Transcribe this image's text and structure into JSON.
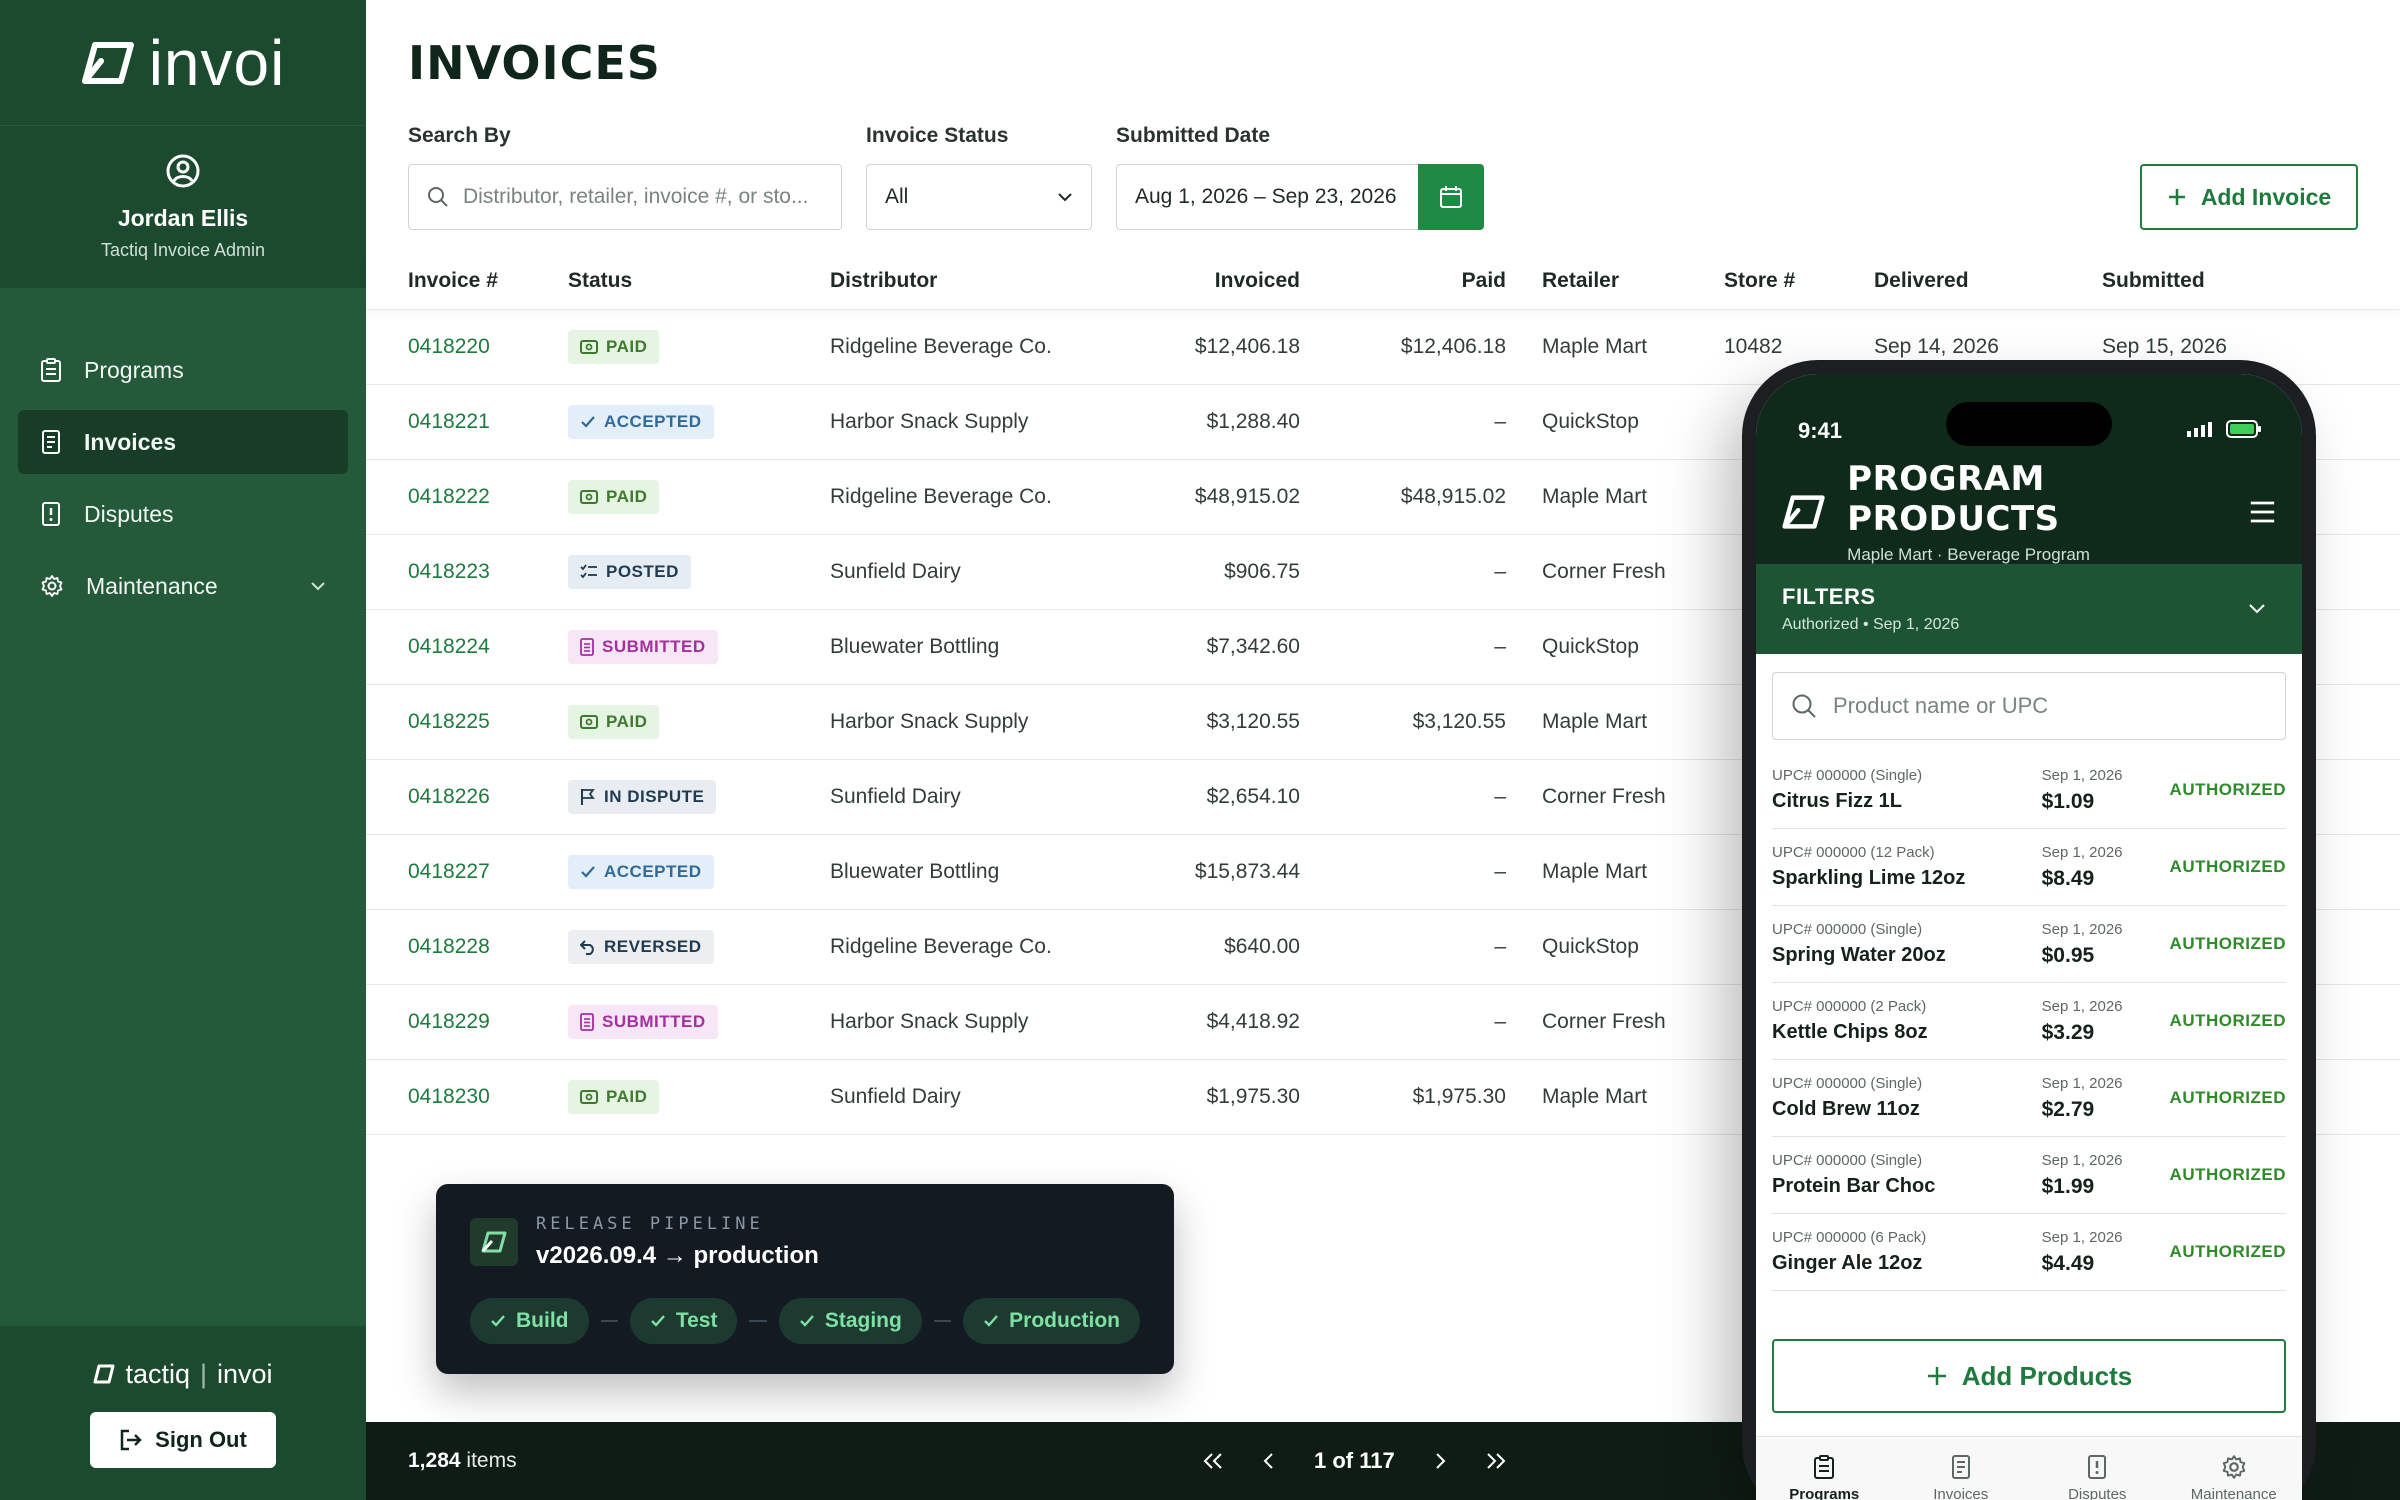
{
  "sidebar": {
    "logo_text": "invoi",
    "user": {
      "name": "Jordan Ellis",
      "role": "Tactiq Invoice Admin"
    },
    "nav": [
      {
        "label": "Programs",
        "icon": "clipboard-icon"
      },
      {
        "label": "Invoices",
        "icon": "document-icon",
        "active": true
      },
      {
        "label": "Disputes",
        "icon": "alert-document-icon"
      },
      {
        "label": "Maintenance",
        "icon": "gear-icon"
      }
    ],
    "brand_left": "tactiq",
    "brand_sep": "|",
    "brand_right": "invoi",
    "signout_label": "Sign Out"
  },
  "page": {
    "title": "INVOICES",
    "search_label": "Search By",
    "search_placeholder": "Distributor, retailer, invoice #, or sto...",
    "status_label": "Invoice Status",
    "status_value": "All",
    "date_label": "Submitted Date",
    "date_value": "Aug 1, 2026 – Sep 23, 2026",
    "add_label": "Add Invoice"
  },
  "table": {
    "headers": [
      "Invoice #",
      "Status",
      "Distributor",
      "Invoiced",
      "Paid",
      "Retailer",
      "Store #",
      "Delivered",
      "Submitted"
    ],
    "rows": [
      [
        "0418220",
        "PAID",
        "Ridgeline Beverage Co.",
        "$12,406.18",
        "$12,406.18",
        "Maple Mart",
        "10482",
        "Sep 14, 2026",
        "Sep 15, 2026"
      ],
      [
        "0418221",
        "ACCEPTED",
        "Harbor Snack Supply",
        "$1,288.40",
        "–",
        "QuickStop",
        "",
        "",
        ""
      ],
      [
        "0418222",
        "PAID",
        "Ridgeline Beverage Co.",
        "$48,915.02",
        "$48,915.02",
        "Maple Mart",
        "",
        "",
        ""
      ],
      [
        "0418223",
        "POSTED",
        "Sunfield Dairy",
        "$906.75",
        "–",
        "Corner Fresh",
        "",
        "",
        ""
      ],
      [
        "0418224",
        "SUBMITTED",
        "Bluewater Bottling",
        "$7,342.60",
        "–",
        "QuickStop",
        "",
        "",
        ""
      ],
      [
        "0418225",
        "PAID",
        "Harbor Snack Supply",
        "$3,120.55",
        "$3,120.55",
        "Maple Mart",
        "",
        "",
        ""
      ],
      [
        "0418226",
        "IN DISPUTE",
        "Sunfield Dairy",
        "$2,654.10",
        "–",
        "Corner Fresh",
        "",
        "",
        ""
      ],
      [
        "0418227",
        "ACCEPTED",
        "Bluewater Bottling",
        "$15,873.44",
        "–",
        "Maple Mart",
        "",
        "",
        ""
      ],
      [
        "0418228",
        "REVERSED",
        "Ridgeline Beverage Co.",
        "$640.00",
        "–",
        "QuickStop",
        "",
        "",
        ""
      ],
      [
        "0418229",
        "SUBMITTED",
        "Harbor Snack Supply",
        "$4,418.92",
        "–",
        "Corner Fresh",
        "",
        "",
        ""
      ],
      [
        "0418230",
        "PAID",
        "Sunfield Dairy",
        "$1,975.30",
        "$1,975.30",
        "Maple Mart",
        "",
        "",
        ""
      ]
    ]
  },
  "release": {
    "label": "RELEASE PIPELINE",
    "version": "v2026.09.4 → production",
    "steps": [
      "Build",
      "Test",
      "Staging",
      "Production"
    ]
  },
  "pager": {
    "count": "1,284",
    "count_suffix": "items",
    "page_text": "1 of 117"
  },
  "phone": {
    "time": "9:41",
    "title": "PROGRAM PRODUCTS",
    "subtitle": "Maple Mart · Beverage Program",
    "filters_title": "FILTERS",
    "filters_sub": "Authorized • Sep 1, 2026",
    "search_placeholder": "Product name or UPC",
    "products": [
      {
        "upc": "UPC# 000000 (Single)",
        "name": "Citrus Fizz 1L",
        "date": "Sep 1, 2026",
        "price": "$1.09",
        "status": "AUTHORIZED"
      },
      {
        "upc": "UPC# 000000 (12 Pack)",
        "name": "Sparkling Lime 12oz",
        "date": "Sep 1, 2026",
        "price": "$8.49",
        "status": "AUTHORIZED"
      },
      {
        "upc": "UPC# 000000 (Single)",
        "name": "Spring Water 20oz",
        "date": "Sep 1, 2026",
        "price": "$0.95",
        "status": "AUTHORIZED"
      },
      {
        "upc": "UPC# 000000 (2 Pack)",
        "name": "Kettle Chips 8oz",
        "date": "Sep 1, 2026",
        "price": "$3.29",
        "status": "AUTHORIZED"
      },
      {
        "upc": "UPC# 000000 (Single)",
        "name": "Cold Brew 11oz",
        "date": "Sep 1, 2026",
        "price": "$2.79",
        "status": "AUTHORIZED"
      },
      {
        "upc": "UPC# 000000 (Single)",
        "name": "Protein Bar Choc",
        "date": "Sep 1, 2026",
        "price": "$1.99",
        "status": "AUTHORIZED"
      },
      {
        "upc": "UPC# 000000 (6 Pack)",
        "name": "Ginger Ale 12oz",
        "date": "Sep 1, 2026",
        "price": "$4.49",
        "status": "AUTHORIZED"
      }
    ],
    "add_label": "Add Products",
    "tabs": [
      {
        "label": "Programs",
        "icon": "clipboard-icon",
        "active": true
      },
      {
        "label": "Invoices",
        "icon": "document-icon"
      },
      {
        "label": "Disputes",
        "icon": "alert-document-icon"
      },
      {
        "label": "Maintenance",
        "icon": "gear-icon"
      }
    ]
  },
  "colors": {
    "sidebar": "#245a3a",
    "sidebar_dark": "#1c4a2f",
    "accent": "#1f7a3e",
    "accent_button": "#1f8a44"
  }
}
